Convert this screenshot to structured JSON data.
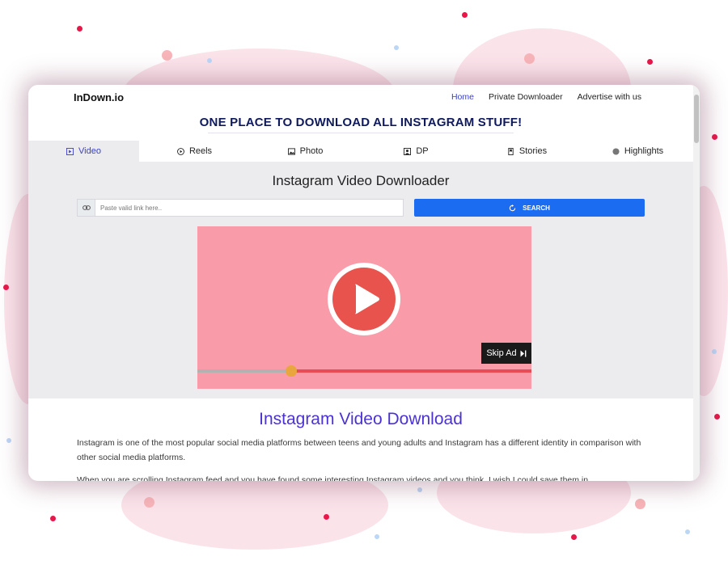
{
  "navbar": {
    "brand": "InDown.io",
    "links": [
      {
        "label": "Home",
        "active": true
      },
      {
        "label": "Private Downloader",
        "active": false
      },
      {
        "label": "Advertise with us",
        "active": false
      }
    ]
  },
  "headline": "ONE PLACE TO DOWNLOAD ALL INSTAGRAM STUFF!",
  "tabs": [
    {
      "label": "Video",
      "icon": "video-icon",
      "active": true
    },
    {
      "label": "Reels",
      "icon": "play-circle-icon",
      "active": false
    },
    {
      "label": "Photo",
      "icon": "image-icon",
      "active": false
    },
    {
      "label": "DP",
      "icon": "profile-icon",
      "active": false
    },
    {
      "label": "Stories",
      "icon": "bookmark-icon",
      "active": false
    },
    {
      "label": "Highlights",
      "icon": "circle-icon",
      "active": false
    }
  ],
  "downloader": {
    "title": "Instagram Video Downloader",
    "search_placeholder": "Paste valid link here..",
    "search_value": "",
    "search_button": "SEARCH",
    "link_icon": "link-icon",
    "search_button_icon": "refresh-icon"
  },
  "ad": {
    "skip_label": "Skip Ad",
    "skip_icon": "skip-next-icon",
    "play_icon": "play-icon",
    "progress_fraction": 0.28
  },
  "article": {
    "title": "Instagram Video Download",
    "paragraphs": [
      "Instagram is one of the most popular social media platforms between teens and young adults and Instagram has a different identity in comparison with other social media platforms.",
      "When you are scrolling Instagram feed and you have found some interesting Instagram videos and you think, I wish I could save them in"
    ]
  },
  "colors": {
    "accent": "#3b3fce",
    "search_button": "#1c6cf2",
    "ad_background": "#f99ba9",
    "play_button": "#e8534d",
    "progress_bar": "#e84c56",
    "progress_knob": "#e9a63c",
    "headline": "#0f1a5c"
  }
}
